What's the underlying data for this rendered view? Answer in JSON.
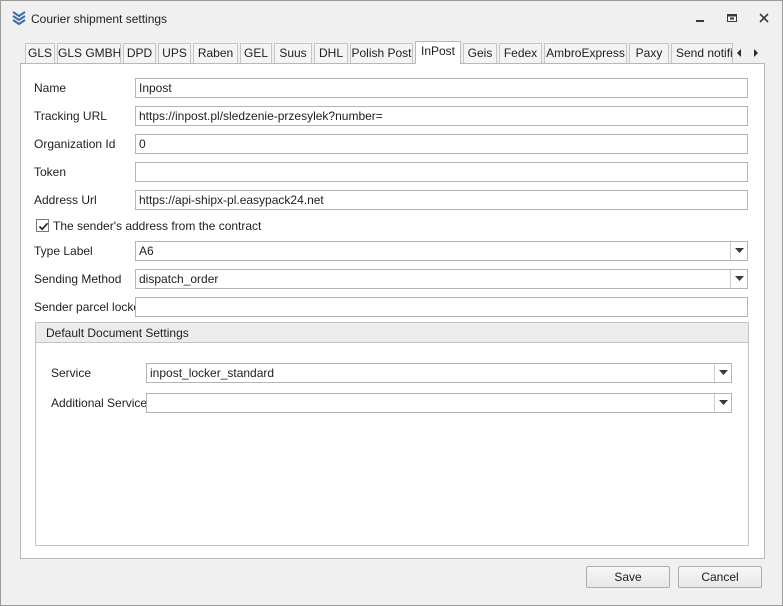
{
  "window": {
    "title": "Courier shipment settings"
  },
  "tabs": [
    {
      "label": "GLS"
    },
    {
      "label": "GLS GMBH"
    },
    {
      "label": "DPD"
    },
    {
      "label": "UPS"
    },
    {
      "label": "Raben"
    },
    {
      "label": "GEL"
    },
    {
      "label": "Suus"
    },
    {
      "label": "DHL"
    },
    {
      "label": "Polish Post"
    },
    {
      "label": "InPost"
    },
    {
      "label": "Geis"
    },
    {
      "label": "Fedex"
    },
    {
      "label": "AmbroExpress"
    },
    {
      "label": "Paxy"
    },
    {
      "label": "Send notifi"
    }
  ],
  "active_tab": "InPost",
  "form": {
    "name": {
      "label": "Name",
      "value": "Inpost"
    },
    "tracking_url": {
      "label": "Tracking URL",
      "value": "https://inpost.pl/sledzenie-przesylek?number="
    },
    "organization_id": {
      "label": "Organization Id",
      "value": "0"
    },
    "token": {
      "label": "Token",
      "value": ""
    },
    "address_url": {
      "label": "Address Url",
      "value": "https://api-shipx-pl.easypack24.net"
    },
    "sender_from_contract": {
      "label": "The sender's address from the contract",
      "checked": true
    },
    "type_label": {
      "label": "Type Label",
      "value": "A6"
    },
    "sending_method": {
      "label": "Sending Method",
      "value": "dispatch_order"
    },
    "sender_parcel_locker": {
      "label": "Sender parcel locker",
      "value": ""
    }
  },
  "default_document": {
    "title": "Default Document Settings",
    "service": {
      "label": "Service",
      "value": "inpost_locker_standard"
    },
    "additional_services": {
      "label": "Additional Services",
      "value": ""
    }
  },
  "buttons": {
    "save": "Save",
    "cancel": "Cancel"
  },
  "colors": {
    "accent": "#3c6ea5",
    "window_bg": "#f0f0f0",
    "panel_bg": "#ffffff",
    "border": "#b4b4b4"
  }
}
